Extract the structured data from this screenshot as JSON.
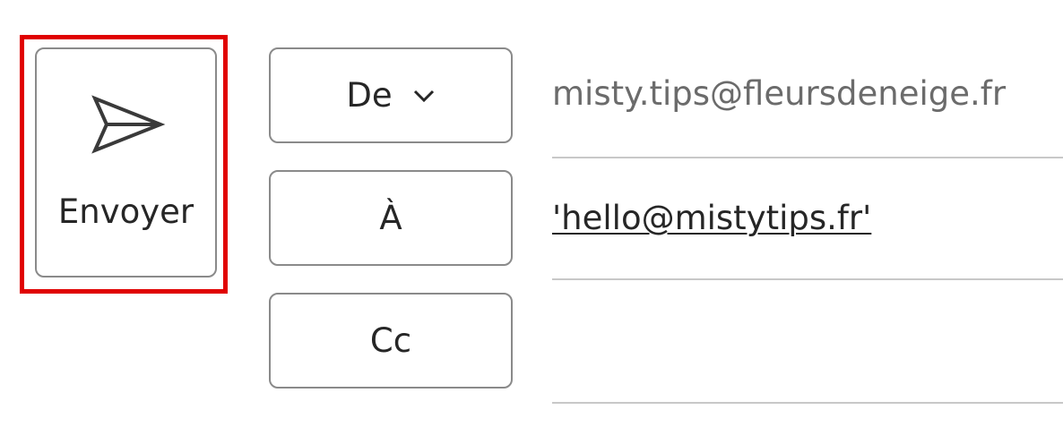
{
  "compose": {
    "send_button": {
      "label": "Envoyer",
      "icon": "send-icon"
    },
    "from": {
      "button_label": "De",
      "icon": "chevron-down-icon",
      "value": "misty.tips@fleursdeneige.fr"
    },
    "to": {
      "button_label": "À",
      "value": "'hello@mistytips.fr'"
    },
    "cc": {
      "button_label": "Cc",
      "value": ""
    }
  },
  "colors": {
    "highlight": "#e00000",
    "border": "#8a8a8a",
    "text": "#262626",
    "muted_text": "#6b6b6b",
    "divider": "#c8c8c8"
  }
}
